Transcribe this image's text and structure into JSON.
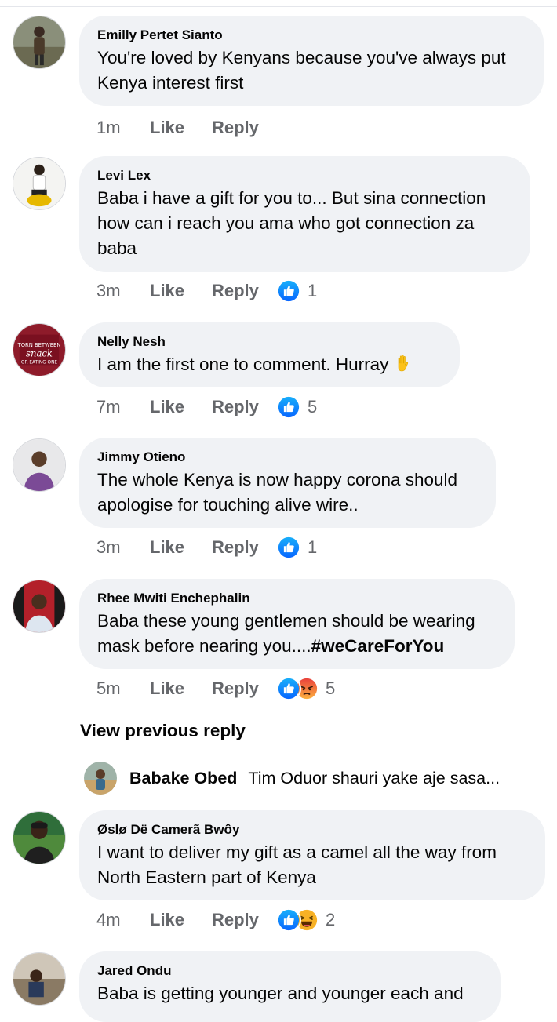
{
  "comments": [
    {
      "author": "Emilly Pertet Sianto",
      "text": "You're loved by Kenyans because you've always put Kenya interest first",
      "time": "1m",
      "like": "Like",
      "reply": "Reply",
      "reactions": [],
      "reaction_count": ""
    },
    {
      "author": "Levi Lex",
      "text": "Baba i have a gift for you to... But sina connection how can i  reach you ama who got connection za baba",
      "time": "3m",
      "like": "Like",
      "reply": "Reply",
      "reactions": [
        "like-reaction"
      ],
      "reaction_count": "1"
    },
    {
      "author": "Nelly Nesh",
      "text": "I am the first one to comment. Hurray",
      "emoji": "raised-hand-emoji",
      "time": "7m",
      "like": "Like",
      "reply": "Reply",
      "reactions": [
        "like-reaction"
      ],
      "reaction_count": "5"
    },
    {
      "author": "Jimmy Otieno",
      "text": "The whole Kenya is now happy corona should apologise for touching alive wire..",
      "time": "3m",
      "like": "Like",
      "reply": "Reply",
      "reactions": [
        "like-reaction"
      ],
      "reaction_count": "1"
    },
    {
      "author": "Rhee Mwiti Enchephalin",
      "text": "Baba these young gentlemen should be wearing mask before nearing you....",
      "hashtag": "#weCareForYou",
      "time": "5m",
      "like": "Like",
      "reply": "Reply",
      "reactions": [
        "like-reaction",
        "angry-reaction"
      ],
      "reaction_count": "5"
    },
    {
      "author": "Øslø Dë Camerã Bwôy",
      "text": "I want to deliver my gift as a camel all the way from North Eastern part of Kenya",
      "time": "4m",
      "like": "Like",
      "reply": "Reply",
      "reactions": [
        "like-reaction",
        "haha-reaction"
      ],
      "reaction_count": "2"
    },
    {
      "author": "Jared Ondu",
      "text": "Baba is getting younger and younger each and"
    }
  ],
  "view_previous": "View previous reply",
  "reply_preview": {
    "author": "Babake Obed",
    "text": "Tim Oduor shauri yake aje sasa..."
  },
  "colors": {
    "bubble": "#f0f2f5",
    "meta": "#65676b",
    "like_blue": "#1877f2",
    "angry_orange": "#f7714c",
    "haha_yellow": "#f7b125"
  }
}
